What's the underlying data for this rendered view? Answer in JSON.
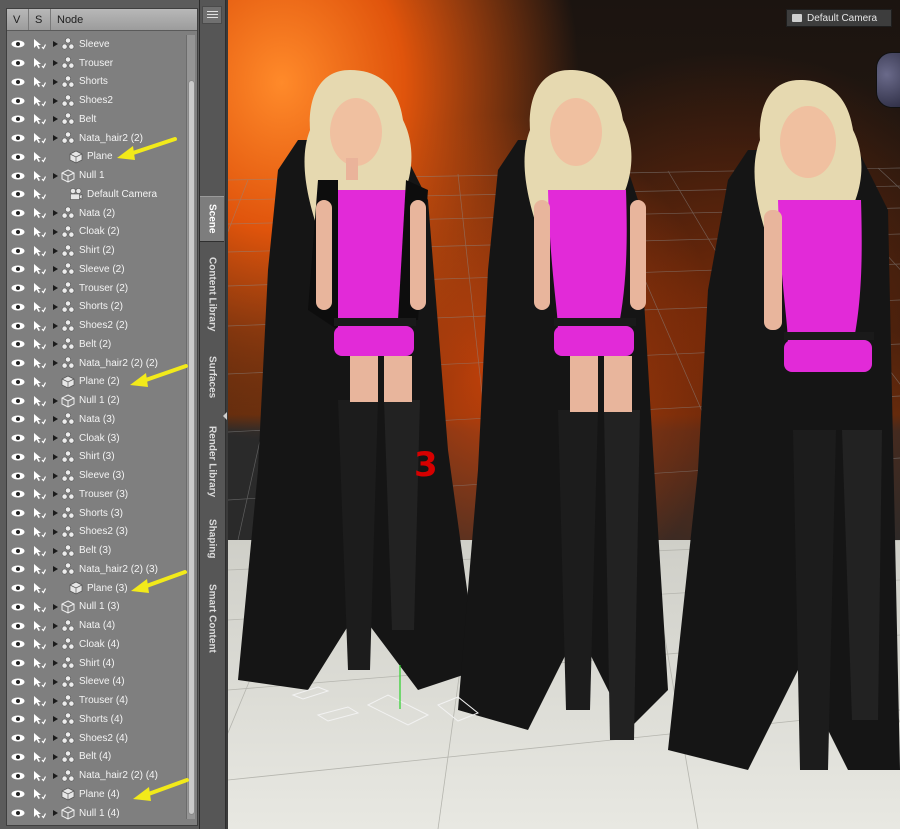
{
  "scene_panel": {
    "header": {
      "v": "V",
      "s": "S",
      "node": "Node"
    },
    "nodes": [
      {
        "label": "Sleeve",
        "type": "figure",
        "indent": 0,
        "arrow": false
      },
      {
        "label": "Trouser",
        "type": "figure",
        "indent": 0,
        "arrow": false
      },
      {
        "label": "Shorts",
        "type": "figure",
        "indent": 0,
        "arrow": false
      },
      {
        "label": "Shoes2",
        "type": "figure",
        "indent": 0,
        "arrow": false
      },
      {
        "label": "Belt",
        "type": "figure",
        "indent": 0,
        "arrow": false
      },
      {
        "label": "Nata_hair2 (2)",
        "type": "figure",
        "indent": 0,
        "arrow": false
      },
      {
        "label": "Plane",
        "type": "prop",
        "indent": 1,
        "arrow": true
      },
      {
        "label": "Null 1",
        "type": "null",
        "indent": 0,
        "arrow": false
      },
      {
        "label": "Default Camera",
        "type": "camera",
        "indent": 1,
        "arrow": false
      },
      {
        "label": "Nata (2)",
        "type": "figure",
        "indent": 0,
        "arrow": false
      },
      {
        "label": "Cloak (2)",
        "type": "figure",
        "indent": 0,
        "arrow": false
      },
      {
        "label": "Shirt (2)",
        "type": "figure",
        "indent": 0,
        "arrow": false
      },
      {
        "label": "Sleeve (2)",
        "type": "figure",
        "indent": 0,
        "arrow": false
      },
      {
        "label": "Trouser (2)",
        "type": "figure",
        "indent": 0,
        "arrow": false
      },
      {
        "label": "Shorts (2)",
        "type": "figure",
        "indent": 0,
        "arrow": false
      },
      {
        "label": "Shoes2 (2)",
        "type": "figure",
        "indent": 0,
        "arrow": false
      },
      {
        "label": "Belt (2)",
        "type": "figure",
        "indent": 0,
        "arrow": false
      },
      {
        "label": "Nata_hair2 (2) (2)",
        "type": "figure",
        "indent": 0,
        "arrow": false
      },
      {
        "label": "Plane (2)",
        "type": "prop",
        "indent": 0,
        "arrow": true
      },
      {
        "label": "Null 1 (2)",
        "type": "null",
        "indent": 0,
        "arrow": false
      },
      {
        "label": "Nata (3)",
        "type": "figure",
        "indent": 0,
        "arrow": false
      },
      {
        "label": "Cloak (3)",
        "type": "figure",
        "indent": 0,
        "arrow": false
      },
      {
        "label": "Shirt (3)",
        "type": "figure",
        "indent": 0,
        "arrow": false
      },
      {
        "label": "Sleeve (3)",
        "type": "figure",
        "indent": 0,
        "arrow": false
      },
      {
        "label": "Trouser (3)",
        "type": "figure",
        "indent": 0,
        "arrow": false
      },
      {
        "label": "Shorts (3)",
        "type": "figure",
        "indent": 0,
        "arrow": false
      },
      {
        "label": "Shoes2 (3)",
        "type": "figure",
        "indent": 0,
        "arrow": false
      },
      {
        "label": "Belt (3)",
        "type": "figure",
        "indent": 0,
        "arrow": false
      },
      {
        "label": "Nata_hair2 (2) (3)",
        "type": "figure",
        "indent": 0,
        "arrow": false
      },
      {
        "label": "Plane (3)",
        "type": "prop",
        "indent": 1,
        "arrow": true
      },
      {
        "label": "Null 1 (3)",
        "type": "null",
        "indent": 0,
        "arrow": false
      },
      {
        "label": "Nata (4)",
        "type": "figure",
        "indent": 0,
        "arrow": false
      },
      {
        "label": "Cloak (4)",
        "type": "figure",
        "indent": 0,
        "arrow": false
      },
      {
        "label": "Shirt (4)",
        "type": "figure",
        "indent": 0,
        "arrow": false
      },
      {
        "label": "Sleeve (4)",
        "type": "figure",
        "indent": 0,
        "arrow": false
      },
      {
        "label": "Trouser (4)",
        "type": "figure",
        "indent": 0,
        "arrow": false
      },
      {
        "label": "Shorts (4)",
        "type": "figure",
        "indent": 0,
        "arrow": false
      },
      {
        "label": "Shoes2 (4)",
        "type": "figure",
        "indent": 0,
        "arrow": false
      },
      {
        "label": "Belt (4)",
        "type": "figure",
        "indent": 0,
        "arrow": false
      },
      {
        "label": "Nata_hair2 (2) (4)",
        "type": "figure",
        "indent": 0,
        "arrow": false
      },
      {
        "label": "Plane (4)",
        "type": "prop",
        "indent": 0,
        "arrow": true
      },
      {
        "label": "Null 1 (4)",
        "type": "null",
        "indent": 0,
        "arrow": false
      }
    ]
  },
  "tabs": [
    {
      "label": "Scene",
      "active": true
    },
    {
      "label": "Content Library",
      "active": false
    },
    {
      "label": "Surfaces",
      "active": false
    },
    {
      "label": "Render Library",
      "active": false
    },
    {
      "label": "Shaping",
      "active": false
    },
    {
      "label": "Smart Content",
      "active": false
    }
  ],
  "viewport": {
    "camera_label": "Default Camera",
    "figure_number": "3"
  },
  "colors": {
    "annotation_arrow": "#f2ea1a",
    "annotation_number": "#d60000",
    "outfit_pink": "#e22ad8",
    "outfit_black": "#111111"
  },
  "icons": {
    "eye": "eye-icon",
    "select": "select-cursor-icon",
    "figure": "figure-node-icon",
    "prop": "prop-cube-icon",
    "null": "null-node-icon",
    "camera": "camera-icon",
    "expand": "expand-triangle-icon"
  }
}
